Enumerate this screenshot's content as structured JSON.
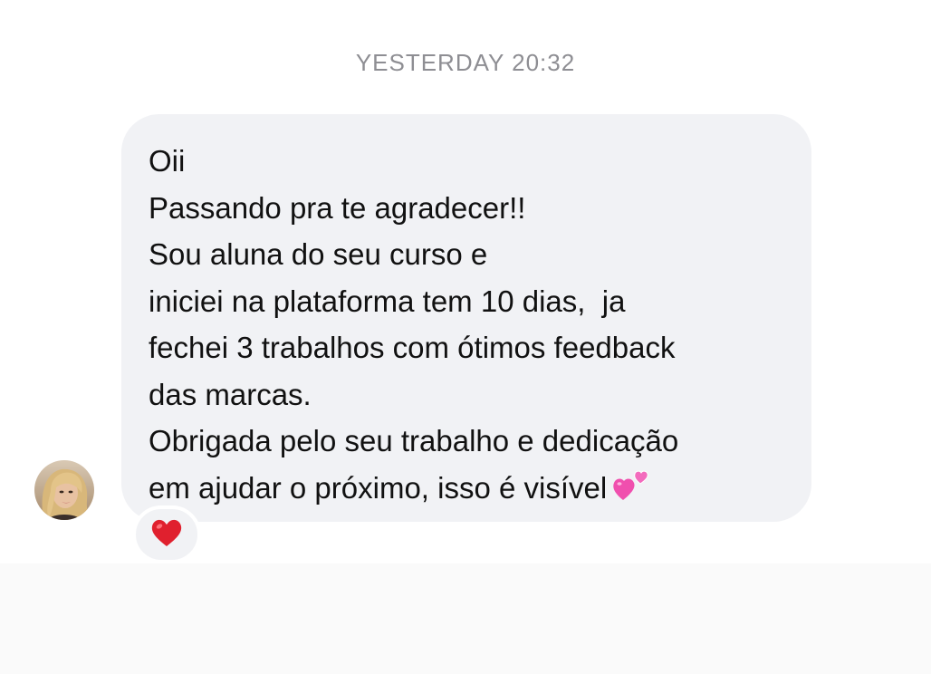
{
  "thread": {
    "timestamp": "YESTERDAY 20:32"
  },
  "message": {
    "lines": [
      "Oii",
      "Passando pra te agradecer!!",
      "Sou aluna do seu curso e",
      "iniciei na plataforma tem 10 dias,  ja",
      "fechei 3 trabalhos com ótimos feedback",
      "das marcas.",
      "Obrigada pelo seu trabalho e dedicação",
      "em ajudar o próximo, isso é visível"
    ],
    "trailing_emoji": "two-hearts-icon",
    "reaction": "heart-icon",
    "colors": {
      "bubble": "#f1f2f5",
      "text": "#111111",
      "timestamp": "#8e8e93",
      "heart": "#e0202e",
      "emoji_hearts": "#f04fae"
    }
  }
}
